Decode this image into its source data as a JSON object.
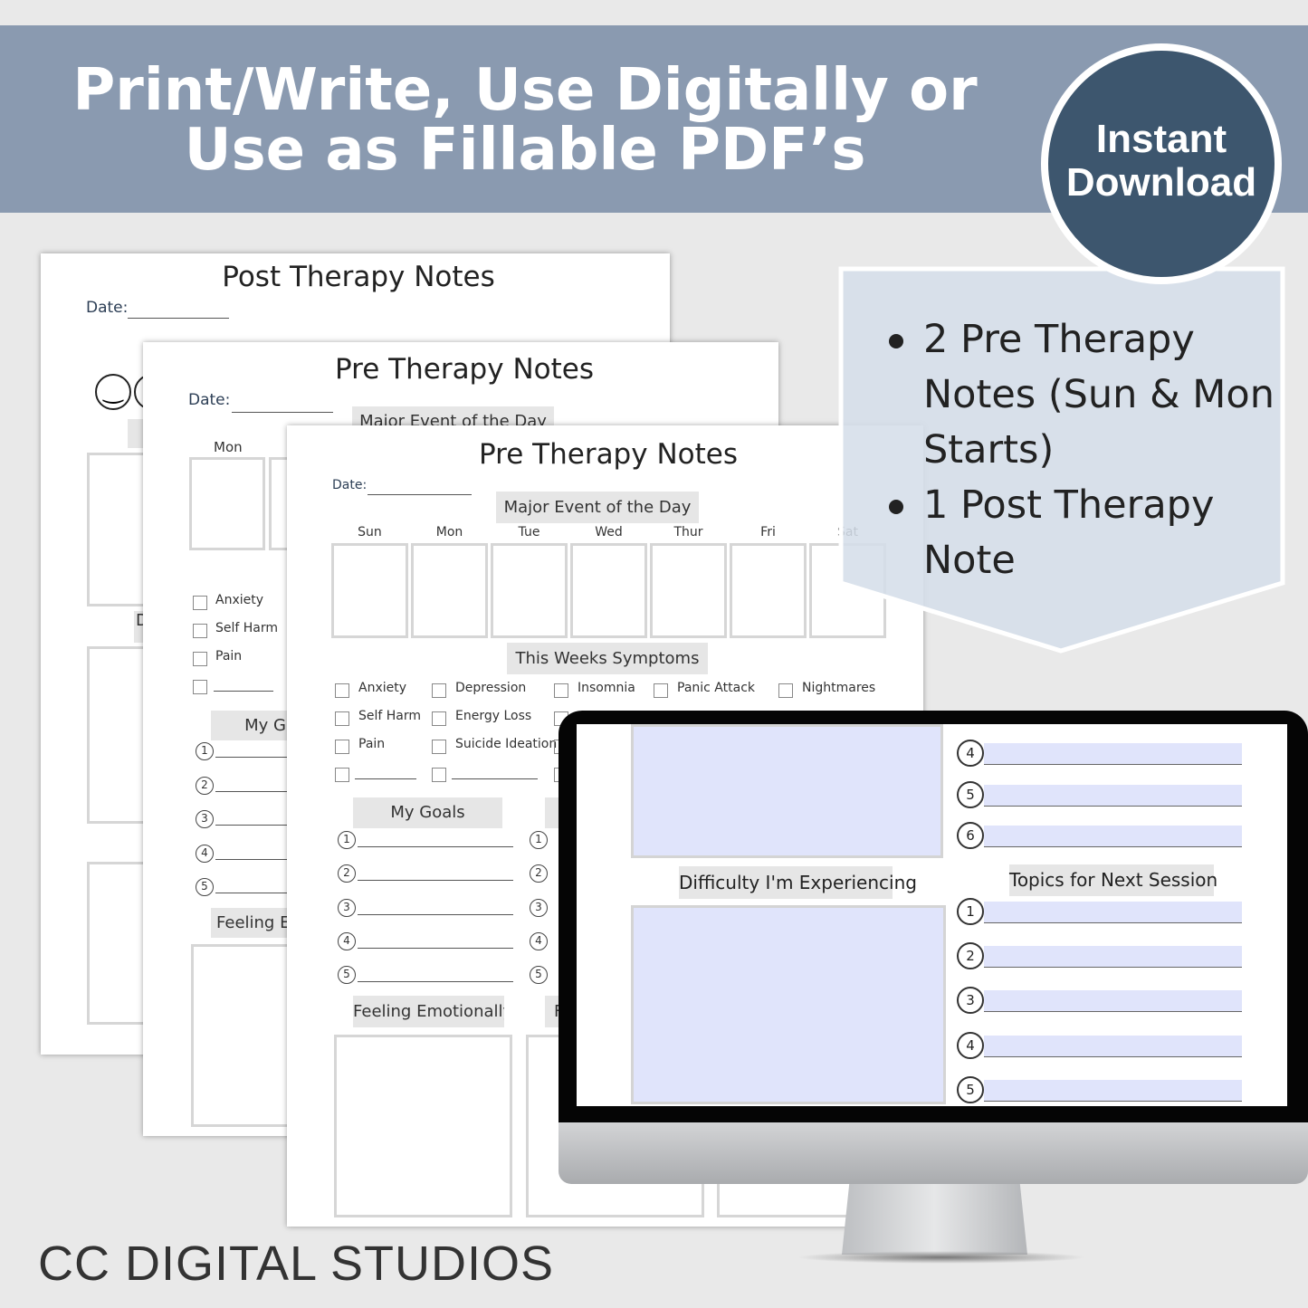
{
  "banner": {
    "line1": "Print/Write, Use Digitally or",
    "line2": "Use as Fillable PDF’s",
    "color": "#8a9ab0"
  },
  "badge": {
    "line1": "Instant",
    "line2": "Download",
    "color": "#3d566e"
  },
  "callout": {
    "bullets": [
      "2 Pre Therapy Notes (Sun & Mon Starts)",
      "1 Post Therapy Note"
    ]
  },
  "post_page": {
    "title": "Post Therapy Notes",
    "date_label": "Date:",
    "partial_label": "D"
  },
  "pre_page_mon": {
    "title": "Pre Therapy Notes",
    "date_label": "Date:",
    "major_event": "Major Event of the Day",
    "day": "Mon",
    "symptoms": [
      "Anxiety",
      "Self Harm",
      "Pain",
      ""
    ],
    "goals_label": "My G",
    "goal_numbers": [
      "1",
      "2",
      "3",
      "4",
      "5"
    ],
    "feeling_label": "Feeling E"
  },
  "pre_page_sun": {
    "title": "Pre Therapy Notes",
    "date_label": "Date:",
    "major_event": "Major Event of the Day",
    "days": [
      "Sun",
      "Mon",
      "Tue",
      "Wed",
      "Thur",
      "Fri",
      "Sat"
    ],
    "symptoms_label": "This Weeks Symptoms",
    "symptoms": [
      [
        "Anxiety",
        "Self Harm",
        "Pain",
        ""
      ],
      [
        "Depression",
        "Energy Loss",
        "Suicide Ideation",
        ""
      ],
      [
        "Insomnia"
      ],
      [
        "Panic Attack"
      ],
      [
        "Nightmares"
      ]
    ],
    "goals_label": "My Goals",
    "goal_numbers": [
      "1",
      "2",
      "3",
      "4",
      "5"
    ],
    "feeling_label": "Feeling Emotionally",
    "partial_label": "F"
  },
  "screen": {
    "top_numbers": [
      "4",
      "5",
      "6"
    ],
    "difficulty_label": "Difficulty I'm Experiencing",
    "topics_label": "Topics for Next Session",
    "topic_numbers": [
      "1",
      "2",
      "3",
      "4",
      "5"
    ],
    "field_color": "#e0e4fb"
  },
  "brand": "CC DIGITAL STUDIOS"
}
